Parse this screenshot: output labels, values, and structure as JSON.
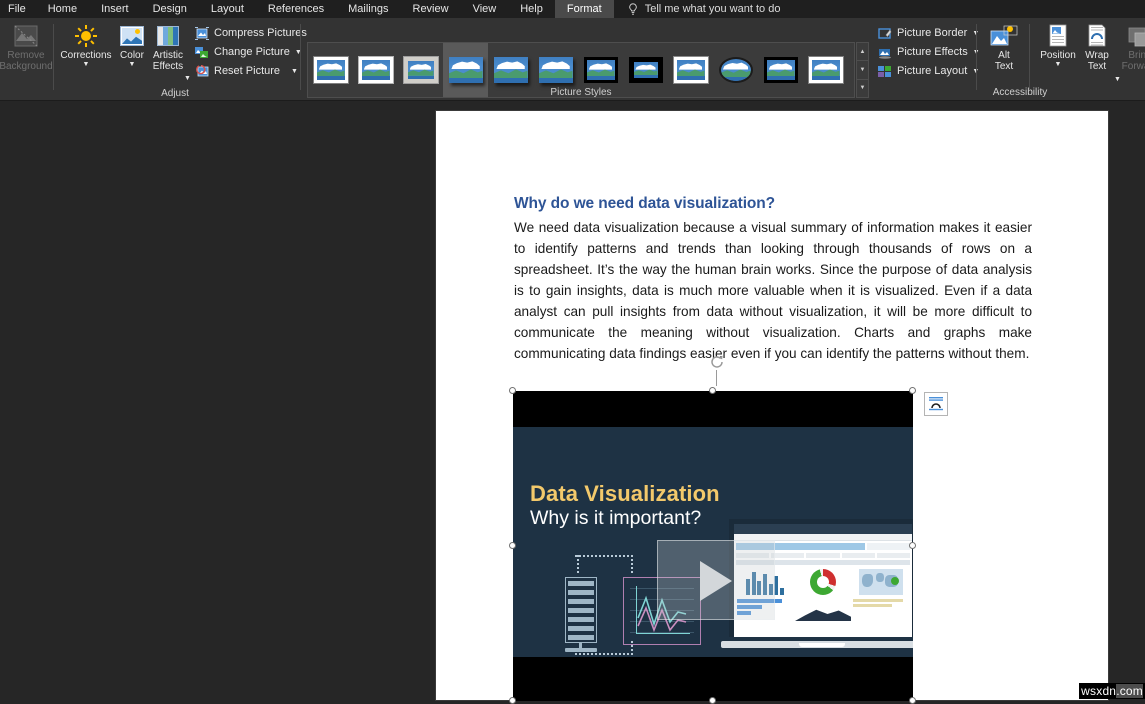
{
  "app": {
    "watermark_prefix": "wsxdn",
    "watermark_suffix": ".com"
  },
  "tabs": [
    {
      "label": "File",
      "active": false
    },
    {
      "label": "Home",
      "active": false
    },
    {
      "label": "Insert",
      "active": false
    },
    {
      "label": "Design",
      "active": false
    },
    {
      "label": "Layout",
      "active": false
    },
    {
      "label": "References",
      "active": false
    },
    {
      "label": "Mailings",
      "active": false
    },
    {
      "label": "Review",
      "active": false
    },
    {
      "label": "View",
      "active": false
    },
    {
      "label": "Help",
      "active": false
    },
    {
      "label": "Format",
      "active": true
    }
  ],
  "tellme": {
    "label": "Tell me what you want to do",
    "icon": "lightbulb-icon"
  },
  "ribbon": {
    "groups": [
      {
        "name": "adjust",
        "label": "Adjust"
      },
      {
        "name": "picture-styles",
        "label": "Picture Styles"
      },
      {
        "name": "accessibility",
        "label": "Accessibility"
      },
      {
        "name": "arrange",
        "label": ""
      }
    ],
    "adjust": {
      "remove_background": "Remove\nBackground",
      "remove_background_l1": "Remove",
      "remove_background_l2": "Background",
      "corrections": "Corrections",
      "color": "Color",
      "artistic_l1": "Artistic",
      "artistic_l2": "Effects",
      "compress_pictures": "Compress Pictures",
      "change_picture": "Change Picture",
      "reset_picture": "Reset Picture"
    },
    "picture_styles": {
      "styles": [
        {
          "name": "simple-frame-white",
          "selected": false
        },
        {
          "name": "beveled-matte-white",
          "selected": false
        },
        {
          "name": "metal-frame",
          "selected": false
        },
        {
          "name": "drop-shadow-rectangle",
          "selected": true
        },
        {
          "name": "reflected-rounded-rectangle",
          "selected": false
        },
        {
          "name": "soft-edge-rectangle",
          "selected": false
        },
        {
          "name": "double-frame-black",
          "selected": false
        },
        {
          "name": "thick-matte-black",
          "selected": false
        },
        {
          "name": "simple-frame-black",
          "selected": false
        },
        {
          "name": "beveled-oval-black",
          "selected": false
        },
        {
          "name": "compound-frame-black",
          "selected": false
        },
        {
          "name": "moderate-frame-white",
          "selected": false
        }
      ],
      "scroll_up": "▲",
      "scroll_down": "▼",
      "more": "▼"
    },
    "picture_border": "Picture Border",
    "picture_effects": "Picture Effects",
    "picture_layout": "Picture Layout",
    "alt_text_l1": "Alt",
    "alt_text_l2": "Text",
    "position": "Position",
    "wrap_text_l1": "Wrap",
    "wrap_text_l2": "Text",
    "bring_forward_l1": "Bring",
    "bring_forward_l2": "Forward"
  },
  "document": {
    "heading": "Why do we need data visualization?",
    "body": "We need data visualization because a visual summary of information makes it easier to identify patterns and trends than looking through thousands of rows on a spreadsheet. It’s the way the human brain works. Since the purpose of data analysis is to gain insights, data is much more valuable when it is visualized. Even if a data analyst can pull insights from data without visualization, it will be more difficult to communicate the meaning without visualization. Charts and graphs make communicating data findings easier even if you can identify the patterns without them.",
    "heading_color": "#2E5496",
    "body_color": "#1A1A1A"
  },
  "picture": {
    "selected": true,
    "title": "Data Visualization",
    "subtitle": "Why is it important?",
    "title_color": "#F3C96B",
    "background_color": "#1E3244",
    "play_button": "play-button",
    "layout_options_icon": "layout-options-icon",
    "rotate_handle": "rotate-handle"
  }
}
